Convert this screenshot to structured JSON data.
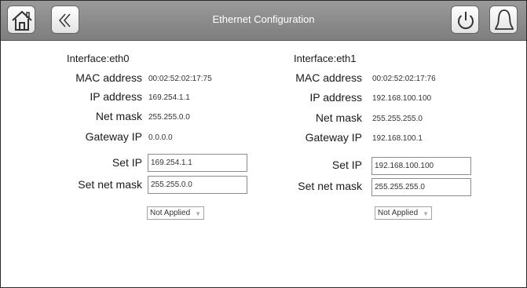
{
  "header": {
    "title": "Ethernet Configuration",
    "icons": {
      "home": "home-icon",
      "back": "chevron-left-double-icon",
      "power": "power-icon",
      "alarm": "bell-icon"
    }
  },
  "labels": {
    "mac": "MAC address",
    "ip": "IP address",
    "netmask": "Net mask",
    "gateway": "Gateway IP",
    "set_ip": "Set IP",
    "set_netmask": "Set net mask"
  },
  "eth0": {
    "interface": "Interface:eth0",
    "mac": "00:02:52:02:17:75",
    "ip": "169.254.1.1",
    "netmask": "255.255.0.0",
    "gateway": "0.0.0.0",
    "set_ip": "169.254.1.1",
    "set_netmask": "255.255.0.0",
    "apply_status": "Not Applied"
  },
  "eth1": {
    "interface": "Interface:eth1",
    "mac": "00:02:52:02:17:76",
    "ip": "192.168.100.100",
    "netmask": "255.255.255.0",
    "gateway": "192.168.100.1",
    "set_ip": "192.168.100.100",
    "set_netmask": "255.255.255.0",
    "apply_status": "Not Applied"
  }
}
